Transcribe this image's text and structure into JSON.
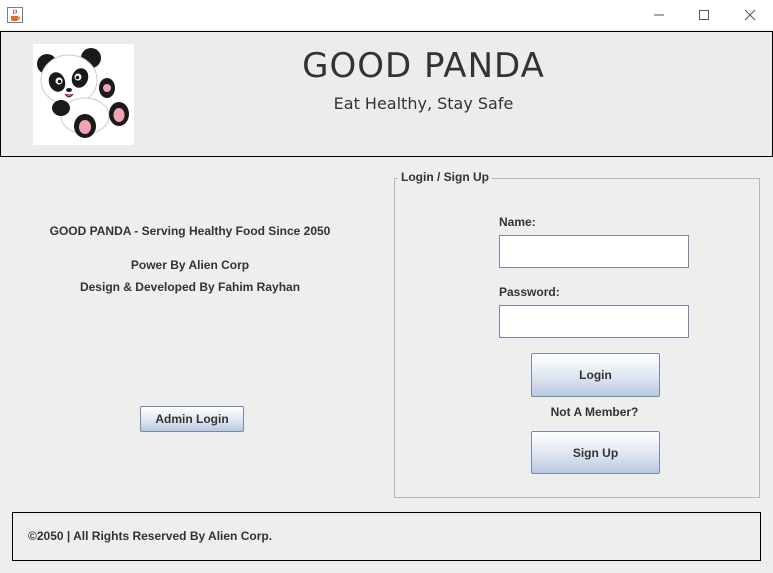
{
  "window": {
    "app_icon": "java-coffee-icon",
    "controls": [
      "minimize-icon",
      "maximize-icon",
      "close-icon"
    ]
  },
  "header": {
    "logo": "panda-logo",
    "title": "GOOD PANDA",
    "subtitle": "Eat Healthy, Stay Safe"
  },
  "info": {
    "line1": "GOOD PANDA  - Serving Healthy Food Since 2050",
    "line2": "Power By Alien Corp",
    "line3": "Design & Developed By Fahim Rayhan"
  },
  "admin_button": "Admin Login",
  "login_panel": {
    "legend": "Login / Sign Up",
    "name_label": "Name:",
    "name_value": "",
    "password_label": "Password:",
    "password_value": "",
    "login_button": "Login",
    "not_member": "Not A Member?",
    "signup_button": "Sign Up"
  },
  "footer": {
    "text": "©2050 | All Rights Reserved By Alien Corp."
  }
}
